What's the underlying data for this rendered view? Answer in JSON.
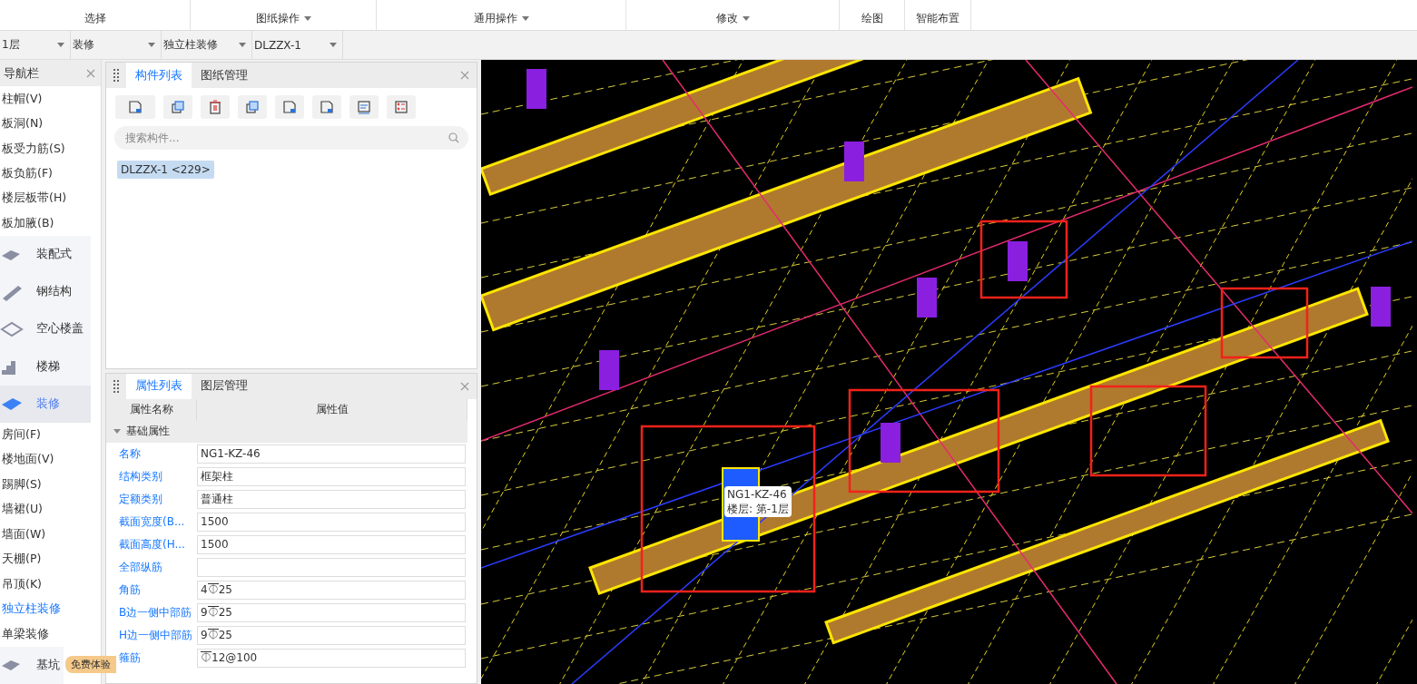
{
  "ribbon_groups": [
    {
      "label": "选择",
      "dropdown": false
    },
    {
      "label": "图纸操作",
      "dropdown": true
    },
    {
      "label": "通用操作",
      "dropdown": true
    },
    {
      "label": "修改",
      "dropdown": true
    },
    {
      "label": "绘图",
      "dropdown": false
    },
    {
      "label": "智能布置",
      "dropdown": false
    }
  ],
  "selectors": [
    "1层",
    "装修",
    "独立柱装修",
    "DLZZX-1"
  ],
  "nav": {
    "title": "导航栏",
    "items": [
      {
        "label": "柱帽(V)",
        "kind": "text",
        "selected": false
      },
      {
        "label": "板洞(N)",
        "kind": "text",
        "selected": false
      },
      {
        "label": "板受力筋(S)",
        "kind": "text",
        "selected": false
      },
      {
        "label": "板负筋(F)",
        "kind": "text",
        "selected": false
      },
      {
        "label": "楼层板带(H)",
        "kind": "text",
        "selected": false
      },
      {
        "label": "板加腋(B)",
        "kind": "text",
        "selected": false
      },
      {
        "label": "装配式",
        "kind": "category",
        "selected": false
      },
      {
        "label": "钢结构",
        "kind": "category",
        "selected": false
      },
      {
        "label": "空心楼盖",
        "kind": "category",
        "selected": false
      },
      {
        "label": "楼梯",
        "kind": "category",
        "selected": false
      },
      {
        "label": "装修",
        "kind": "category",
        "selected": true
      },
      {
        "label": "房间(F)",
        "kind": "text",
        "selected": false
      },
      {
        "label": "楼地面(V)",
        "kind": "text",
        "selected": false
      },
      {
        "label": "踢脚(S)",
        "kind": "text",
        "selected": false
      },
      {
        "label": "墙裙(U)",
        "kind": "text",
        "selected": false
      },
      {
        "label": "墙面(W)",
        "kind": "text",
        "selected": false
      },
      {
        "label": "天棚(P)",
        "kind": "text",
        "selected": false
      },
      {
        "label": "吊顶(K)",
        "kind": "text",
        "selected": false
      },
      {
        "label": "独立柱装修",
        "kind": "text",
        "selected": true
      },
      {
        "label": "单梁装修",
        "kind": "text",
        "selected": false
      },
      {
        "label": "基坑",
        "kind": "category",
        "selected": false
      }
    ],
    "badge": "免费体验"
  },
  "component_panel": {
    "tabs": [
      {
        "label": "构件列表",
        "selected": true
      },
      {
        "label": "图纸管理",
        "selected": false
      }
    ],
    "search": {
      "placeholder": "搜索构件..."
    },
    "items": [
      {
        "label": "DLZZX-1 <229>",
        "selected": true
      }
    ]
  },
  "property_panel": {
    "tabs": [
      {
        "label": "属性列表",
        "selected": true
      },
      {
        "label": "图层管理",
        "selected": false
      }
    ],
    "columns": [
      "属性名称",
      "属性值"
    ],
    "group": {
      "label": "基础属性",
      "expanded": true
    },
    "rows": [
      {
        "name": "名称",
        "value": "NG1-KZ-46"
      },
      {
        "name": "结构类别",
        "value": "框架柱"
      },
      {
        "name": "定额类别",
        "value": "普通柱"
      },
      {
        "name": "截面宽度(B...",
        "value": "1500"
      },
      {
        "name": "截面高度(H...",
        "value": "1500"
      },
      {
        "name": "全部纵筋",
        "value": ""
      },
      {
        "name": "角筋",
        "value": "4⏁25"
      },
      {
        "name": "B边一侧中部筋",
        "value": "9⏁25"
      },
      {
        "name": "H边一侧中部筋",
        "value": "9⏁25"
      },
      {
        "name": "箍筋",
        "value": "⏁12@100"
      }
    ]
  },
  "canvas": {
    "tooltip": [
      "NG1-KZ-46",
      "楼层: 第-1层"
    ]
  }
}
